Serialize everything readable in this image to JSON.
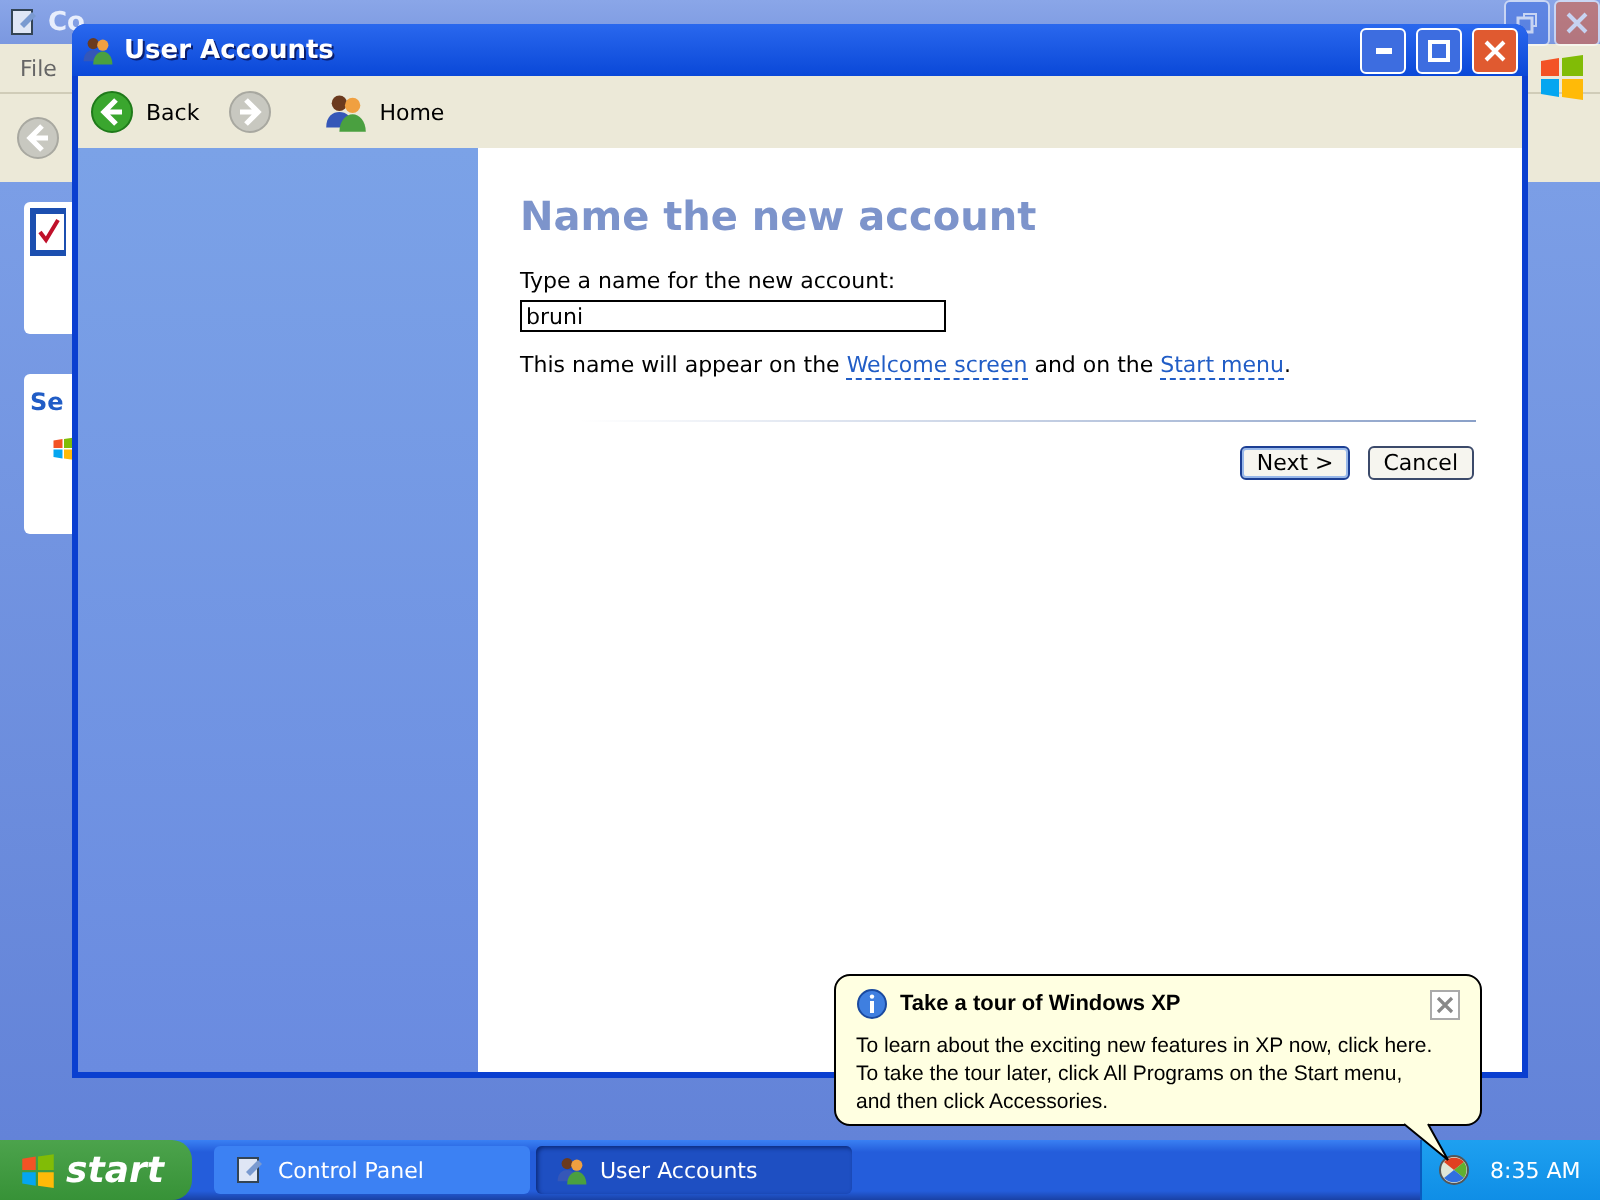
{
  "background_window": {
    "title": "Co",
    "menu": [
      "File"
    ],
    "side_panel_heading": "Se"
  },
  "window": {
    "title": "User Accounts",
    "toolbar": [
      {
        "kind": "back",
        "label": "Back",
        "disabled": false
      },
      {
        "kind": "forward",
        "disabled": true
      },
      {
        "kind": "home",
        "label": "Home"
      }
    ]
  },
  "page": {
    "heading": "Name the new account",
    "name_label": "Type a name for the new account:",
    "name_field": {
      "value": "bruni"
    },
    "note": [
      {
        "kind": "text",
        "text": "This name will appear on the "
      },
      {
        "kind": "link",
        "text": "Welcome screen"
      },
      {
        "kind": "text",
        "text": " and on the "
      },
      {
        "kind": "link",
        "text": "Start menu"
      },
      {
        "kind": "text",
        "text": "."
      }
    ],
    "buttons": [
      {
        "label": "Next >",
        "default": true
      },
      {
        "label": "Cancel",
        "default": false
      }
    ]
  },
  "balloon": {
    "title": "Take a tour of Windows XP",
    "lines": [
      "To learn about the exciting new features in XP now, click here.",
      "To take the tour later, click All Programs on the Start menu,",
      "and then click Accessories."
    ]
  },
  "taskbar": {
    "start": "start",
    "tasks": [
      {
        "kind": "control-panel",
        "label": "Control Panel",
        "selected": false
      },
      {
        "kind": "users",
        "label": "User Accounts",
        "selected": true
      }
    ],
    "clock": "8:35 AM"
  }
}
